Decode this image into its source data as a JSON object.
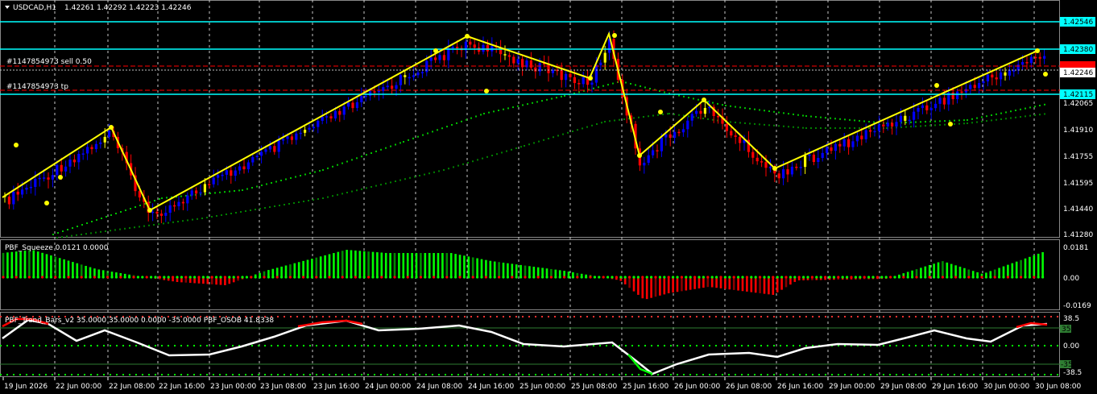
{
  "header": {
    "symbol": "USDCAD,H1",
    "ohlc": "1.42261 1.42292 1.42223 1.42246"
  },
  "orders": {
    "sell_label": "#1147854973 sell 0.50",
    "tp_label": "#1147854973 tp"
  },
  "price_axis": {
    "ticks": [
      "1.42065",
      "1.41910",
      "1.41755",
      "1.41595",
      "1.41440",
      "1.41280"
    ],
    "tags": [
      {
        "value": "1.42546",
        "bg": "#00ffff"
      },
      {
        "value": "1.42380",
        "bg": "#00ffff"
      },
      {
        "value": "1.42246",
        "bg": "#ffffff"
      },
      {
        "value": "1.42115",
        "bg": "#00ffff"
      }
    ]
  },
  "squeeze": {
    "title": "PBF_Squeeze 0.0121 0.0000",
    "ticks": [
      "0.0181",
      "0.00",
      "-0.0169"
    ]
  },
  "osob": {
    "title": "PBF_Trend_Bars_v2 35.0000 35.0000 0.0000 -35.0000  PBF_OSOB 41.8338",
    "ticks": [
      "38.5",
      "0.00",
      "-38.5"
    ],
    "tag_upper": "35",
    "tag_lower": "-35"
  },
  "time_axis": [
    "19 Jun 2026",
    "22 Jun 00:00",
    "22 Jun 08:00",
    "22 Jun 16:00",
    "23 Jun 00:00",
    "23 Jun 08:00",
    "23 Jun 16:00",
    "24 Jun 00:00",
    "24 Jun 08:00",
    "24 Jun 16:00",
    "25 Jun 00:00",
    "25 Jun 08:00",
    "25 Jun 16:00",
    "26 Jun 00:00",
    "26 Jun 08:00",
    "26 Jun 16:00",
    "29 Jun 00:00",
    "29 Jun 08:00",
    "29 Jun 16:00",
    "30 Jun 00:00",
    "30 Jun 08:00"
  ],
  "colors": {
    "bull": "#0000ff",
    "bear": "#ff0000",
    "neutral": "#ffff00",
    "zigzag": "#ffff00",
    "level": "#00ffff",
    "ma_fast": "#00c000",
    "ma_slow": "#008000",
    "squeeze_pos": "#00ff00",
    "squeeze_neg": "#ff0000",
    "osob_line": "#ffffff"
  },
  "chart_data": {
    "type": "candlestick",
    "title": "USDCAD,H1",
    "ylim": [
      1.4124,
      1.4265
    ],
    "levels": [
      1.42546,
      1.4238,
      1.42115
    ],
    "zigzag": [
      {
        "t": "19 Jun 2026",
        "v": 1.4152
      },
      {
        "t": "22 Jun 08:00",
        "v": 1.4192
      },
      {
        "t": "22 Jun 16:00",
        "v": 1.4142
      },
      {
        "t": "24 Jun 08:00",
        "v": 1.4243
      },
      {
        "t": "25 Jun 08:00",
        "v": 1.4223
      },
      {
        "t": "25 Jun 08:00",
        "v": 1.4243
      },
      {
        "t": "25 Jun 16:00",
        "v": 1.4178
      },
      {
        "t": "26 Jun 00:00",
        "v": 1.4207
      },
      {
        "t": "26 Jun 16:00",
        "v": 1.4169
      },
      {
        "t": "30 Jun 08:00",
        "v": 1.4238
      }
    ]
  }
}
